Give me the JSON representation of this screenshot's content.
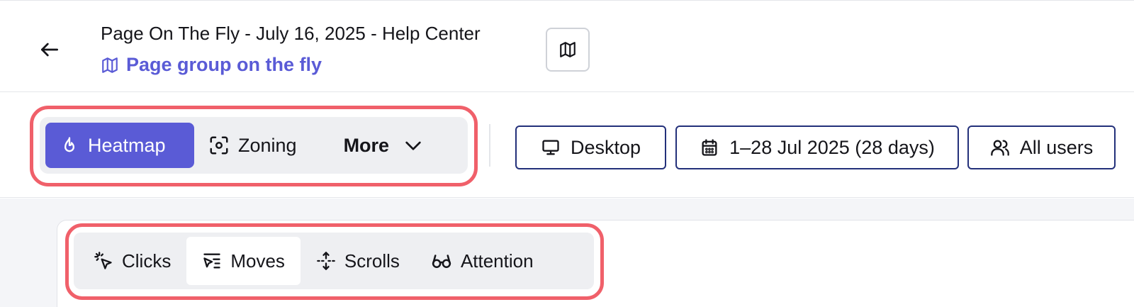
{
  "header": {
    "title": "Page On The Fly - July 16, 2025 - Help Center",
    "group_link": "Page group on the fly",
    "icons": {
      "back": "arrow-left-icon",
      "group": "map-icon",
      "map_button": "map-icon"
    }
  },
  "view_tabs": [
    {
      "label": "Heatmap",
      "icon": "flame-icon",
      "active": true
    },
    {
      "label": "Zoning",
      "icon": "focus-icon",
      "active": false
    },
    {
      "label": "More",
      "icon": "chevron-down-icon",
      "active": false
    }
  ],
  "filters": {
    "device": "Desktop",
    "date_range": "1–28 Jul 2025 (28 days)",
    "segment": "All users"
  },
  "heatmap_tabs": [
    {
      "label": "Clicks",
      "icon": "click-cursor-icon",
      "active": false
    },
    {
      "label": "Moves",
      "icon": "move-cursor-icon",
      "active": true
    },
    {
      "label": "Scrolls",
      "icon": "scroll-arrows-icon",
      "active": false
    },
    {
      "label": "Attention",
      "icon": "glasses-icon",
      "active": false
    }
  ],
  "colors": {
    "accent": "#5a5bd6",
    "highlight": "#f0606a",
    "filter_border": "#23307a",
    "segment_bg": "#eeeff2"
  }
}
